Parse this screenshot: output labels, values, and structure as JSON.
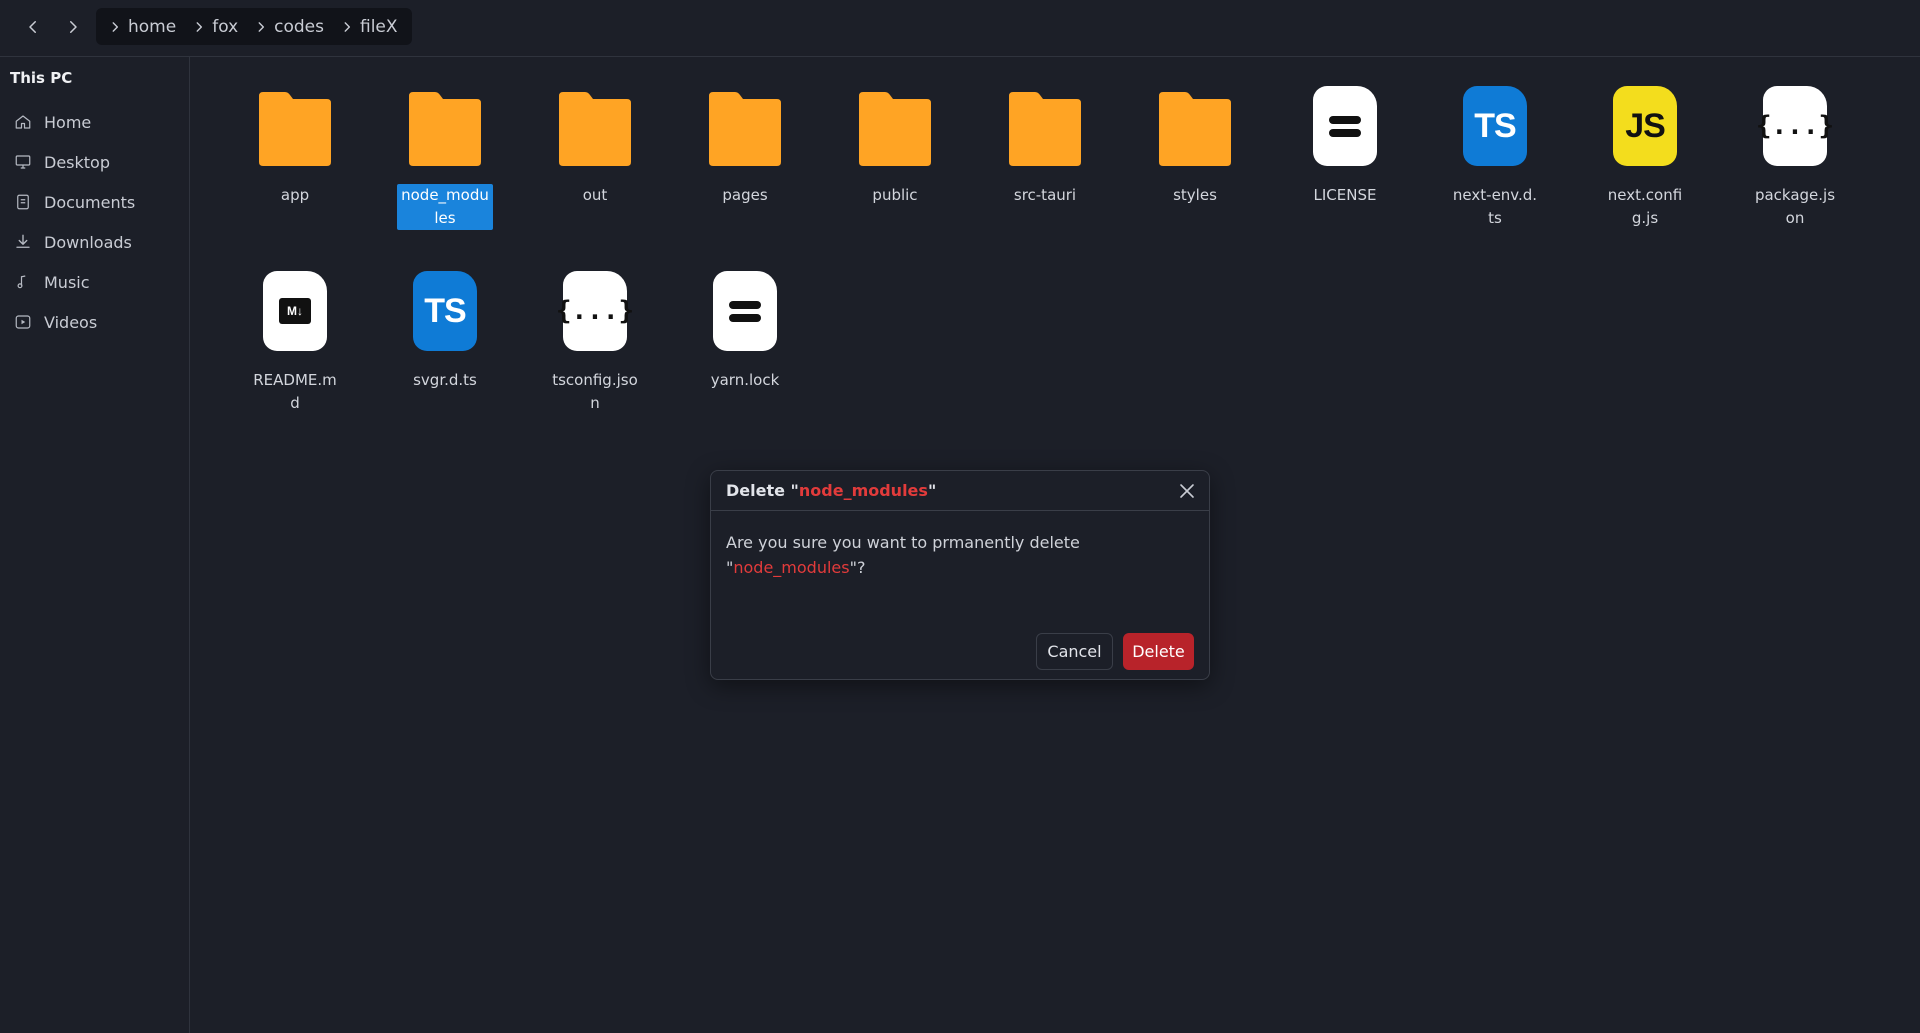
{
  "breadcrumb": [
    "home",
    "fox",
    "codes",
    "fileX"
  ],
  "sidebar": {
    "title": "This PC",
    "items": [
      {
        "label": "Home",
        "icon": "home-icon"
      },
      {
        "label": "Desktop",
        "icon": "desktop-icon"
      },
      {
        "label": "Documents",
        "icon": "document-icon"
      },
      {
        "label": "Downloads",
        "icon": "download-icon"
      },
      {
        "label": "Music",
        "icon": "music-icon"
      },
      {
        "label": "Videos",
        "icon": "video-icon"
      }
    ]
  },
  "files": [
    {
      "name": "app",
      "type": "folder"
    },
    {
      "name": "node_modules",
      "type": "folder",
      "selected": true
    },
    {
      "name": "out",
      "type": "folder"
    },
    {
      "name": "pages",
      "type": "folder"
    },
    {
      "name": "public",
      "type": "folder"
    },
    {
      "name": "src-tauri",
      "type": "folder"
    },
    {
      "name": "styles",
      "type": "folder"
    },
    {
      "name": "LICENSE",
      "type": "text"
    },
    {
      "name": "next-env.d.ts",
      "type": "typescript"
    },
    {
      "name": "next.config.js",
      "type": "javascript"
    },
    {
      "name": "package.json",
      "type": "json"
    },
    {
      "name": "README.md",
      "type": "markdown"
    },
    {
      "name": "svgr.d.ts",
      "type": "typescript"
    },
    {
      "name": "tsconfig.json",
      "type": "json"
    },
    {
      "name": "yarn.lock",
      "type": "text"
    }
  ],
  "icon_text": {
    "typescript": "TS",
    "javascript": "JS",
    "json": "{...}",
    "markdown": "M↓"
  },
  "dialog": {
    "title_prefix": "Delete \"",
    "target": "node_modules",
    "title_suffix": "\"",
    "body_prefix": "Are you sure you want to prmanently delete \"",
    "body_suffix": "\"?",
    "cancel_label": "Cancel",
    "delete_label": "Delete"
  },
  "colors": {
    "folder": "#ffa424",
    "selection": "#1a84dc",
    "danger": "#b8232a",
    "danger_text": "#e23b3b"
  }
}
